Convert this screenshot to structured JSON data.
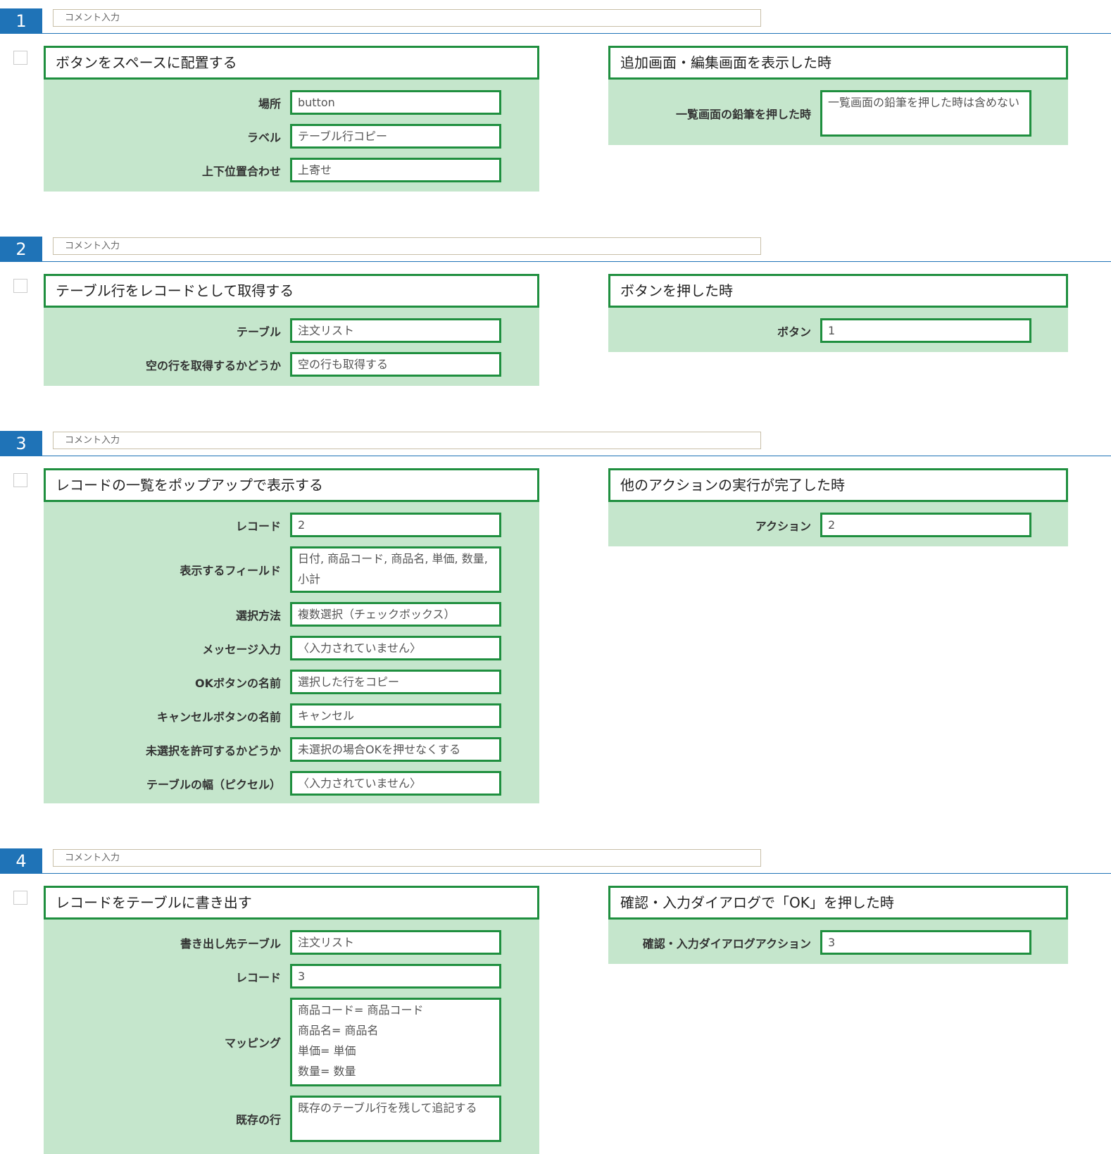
{
  "steps": [
    {
      "number": "1",
      "comment_placeholder": "コメント入力",
      "action": {
        "title": "ボタンをスペースに配置する",
        "params": [
          {
            "label": "場所",
            "value": "button"
          },
          {
            "label": "ラベル",
            "value": "テーブル行コピー"
          },
          {
            "label": "上下位置合わせ",
            "value": "上寄せ"
          }
        ]
      },
      "trigger": {
        "title": "追加画面・編集画面を表示した時",
        "params": [
          {
            "label": "一覧画面の鉛筆を押した時",
            "value": "一覧画面の鉛筆を押した時は含めない"
          }
        ]
      }
    },
    {
      "number": "2",
      "comment_placeholder": "コメント入力",
      "action": {
        "title": "テーブル行をレコードとして取得する",
        "params": [
          {
            "label": "テーブル",
            "value": "注文リスト"
          },
          {
            "label": "空の行を取得するかどうか",
            "value": "空の行も取得する"
          }
        ]
      },
      "trigger": {
        "title": "ボタンを押した時",
        "params": [
          {
            "label": "ボタン",
            "value": "1"
          }
        ]
      }
    },
    {
      "number": "3",
      "comment_placeholder": "コメント入力",
      "action": {
        "title": "レコードの一覧をポップアップで表示する",
        "params": [
          {
            "label": "レコード",
            "value": "2"
          },
          {
            "label": "表示するフィールド",
            "value": "日付, 商品コード, 商品名, 単価, 数量, 小計"
          },
          {
            "label": "選択方法",
            "value": "複数選択（チェックボックス）"
          },
          {
            "label": "メッセージ入力",
            "value": "〈入力されていません〉"
          },
          {
            "label": "OKボタンの名前",
            "value": "選択した行をコピー"
          },
          {
            "label": "キャンセルボタンの名前",
            "value": "キャンセル"
          },
          {
            "label": "未選択を許可するかどうか",
            "value": "未選択の場合OKを押せなくする"
          },
          {
            "label": "テーブルの幅（ピクセル）",
            "value": "〈入力されていません〉"
          }
        ]
      },
      "trigger": {
        "title": "他のアクションの実行が完了した時",
        "params": [
          {
            "label": "アクション",
            "value": "2"
          }
        ]
      }
    },
    {
      "number": "4",
      "comment_placeholder": "コメント入力",
      "action": {
        "title": "レコードをテーブルに書き出す",
        "params": [
          {
            "label": "書き出し先テーブル",
            "value": "注文リスト"
          },
          {
            "label": "レコード",
            "value": "3"
          },
          {
            "label": "マッピング",
            "value": "商品コード= 商品コード\n商品名= 商品名\n単価= 単価\n数量= 数量"
          },
          {
            "label": "既存の行",
            "value": "既存のテーブル行を残して追記する"
          }
        ]
      },
      "trigger": {
        "title": "確認・入力ダイアログで「OK」を押した時",
        "params": [
          {
            "label": "確認・入力ダイアログアクション",
            "value": "3"
          }
        ]
      }
    }
  ],
  "colors": {
    "step_accent": "#1f73b7",
    "block_bg": "#c5e6cc",
    "block_border": "#1f8f3f"
  }
}
